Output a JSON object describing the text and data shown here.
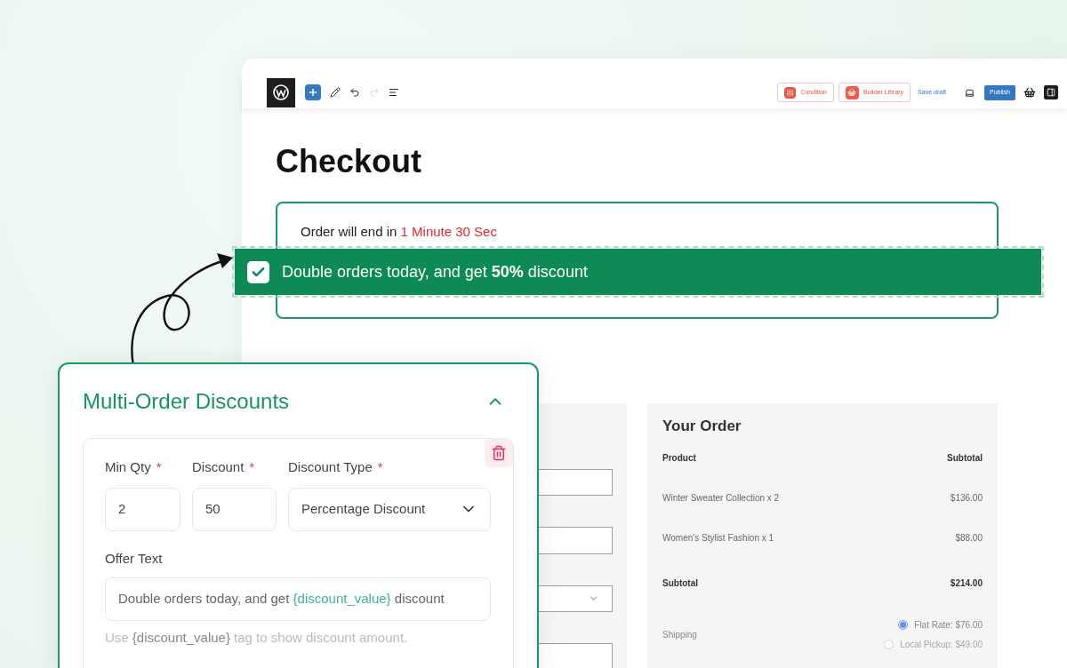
{
  "toolbar": {
    "tools": [
      {
        "kind": "add",
        "disabled": false
      },
      {
        "kind": "pen",
        "disabled": false
      },
      {
        "kind": "undo",
        "disabled": false
      },
      {
        "kind": "redo",
        "disabled": true
      },
      {
        "kind": "list",
        "disabled": false
      }
    ],
    "actions": [
      {
        "kind": "condition",
        "label": "Condition"
      },
      {
        "kind": "library",
        "label": "Builder Library"
      }
    ],
    "save_draft": "Save draft",
    "publish": "Publish"
  },
  "page": {
    "title": "Checkout",
    "countdown": {
      "prefix": "Order will end in ",
      "time": "1 Minute 30 Sec"
    }
  },
  "offer_banner": {
    "checked": true,
    "text": "Double orders today, and get **50%** discount"
  },
  "billing": {
    "fields": [
      {
        "kind": "text"
      },
      {
        "kind": "text"
      },
      {
        "kind": "select"
      },
      {
        "kind": "text"
      }
    ]
  },
  "order_summary": {
    "title": "Your Order",
    "columns": [
      "Product",
      "Subtotal"
    ],
    "rows": [
      {
        "product": "Winter Sweater Collection x 2",
        "subtotal": "$136.00"
      },
      {
        "product": "Women's Stylist Fashion x 1",
        "subtotal": "$88.00"
      }
    ],
    "subtotal": {
      "label": "Subtotal",
      "value": "$214.00"
    },
    "shipping": {
      "label": "Shipping",
      "options": [
        {
          "label": "Flat Rate: $76.00",
          "selected": true
        },
        {
          "label": "Local Pickup: $49.00",
          "selected": false
        }
      ]
    }
  },
  "discount_panel": {
    "title": "Multi-Order Discounts",
    "expanded": true,
    "fields": [
      {
        "kind": "text",
        "label": "Min Qty",
        "required_mark": "*",
        "value": "2"
      },
      {
        "kind": "text",
        "label": "Discount",
        "required_mark": "*",
        "value": "50"
      },
      {
        "kind": "select",
        "label": "Discount Type",
        "required_mark": "*",
        "value": "Percentage Discount"
      }
    ],
    "offer_text": {
      "label": "Offer Text",
      "value": [
        {
          "kind": "plain",
          "text": "Double orders today, and get "
        },
        {
          "kind": "tag",
          "text": "{discount_value}"
        },
        {
          "kind": "plain",
          "text": " discount"
        }
      ]
    },
    "hint": [
      {
        "kind": "plain",
        "text": "Use "
      },
      {
        "kind": "tag",
        "text": "{discount_value}"
      },
      {
        "kind": "plain",
        "text": " tag to show discount amount."
      }
    ]
  }
}
